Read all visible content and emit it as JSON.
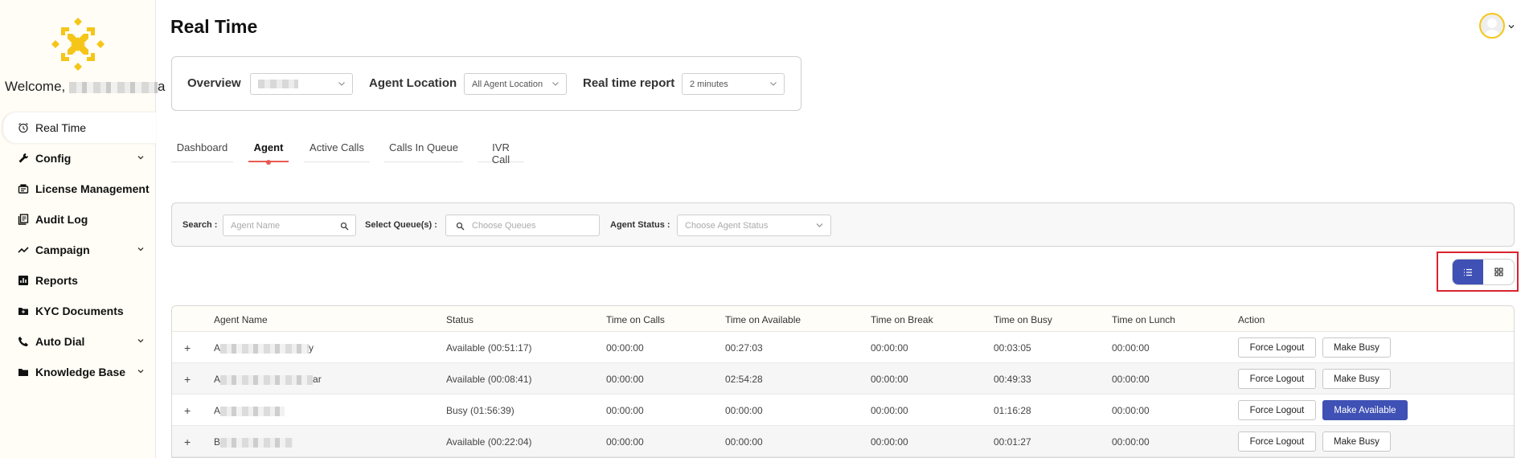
{
  "sidebar": {
    "welcome": "Welcome,",
    "welcome_tail": "a",
    "items": [
      {
        "label": "Real Time",
        "icon": "alarm-clock-icon"
      },
      {
        "label": "Config",
        "icon": "wrench-icon"
      },
      {
        "label": "License Management",
        "icon": "license-icon"
      },
      {
        "label": "Audit Log",
        "icon": "log-icon"
      },
      {
        "label": "Campaign",
        "icon": "trend-icon"
      },
      {
        "label": "Reports",
        "icon": "bar-chart-icon"
      },
      {
        "label": "KYC Documents",
        "icon": "folder-icon"
      },
      {
        "label": "Auto Dial",
        "icon": "phone-icon"
      },
      {
        "label": "Knowledge Base",
        "icon": "folder-icon"
      }
    ]
  },
  "header": {
    "title": "Real Time"
  },
  "overview": {
    "label": "Overview",
    "agent_location_label": "Agent Location",
    "agent_location_value": "All Agent Location",
    "report_label": "Real time report",
    "report_value": "2 minutes"
  },
  "tabs": [
    "Dashboard",
    "Agent",
    "Active Calls",
    "Calls In Queue",
    "IVR Call"
  ],
  "filters": {
    "search_label": "Search :",
    "search_placeholder": "Agent Name",
    "queue_label": "Select Queue(s) :",
    "queue_placeholder": "Choose Queues",
    "status_label": "Agent Status :",
    "status_placeholder": "Choose Agent Status"
  },
  "colors": {
    "accent": "#3f51b5",
    "tab_active": "#e85a4f",
    "brand": "#f5c518",
    "highlight": "#d9232e"
  },
  "table": {
    "headers": [
      "Agent Name",
      "Status",
      "Time on Calls",
      "Time on Available",
      "Time on Break",
      "Time on Busy",
      "Time on Lunch",
      "Action"
    ],
    "rows": [
      {
        "name_head": "A",
        "name_tail": "y",
        "status": "Available (00:51:17)",
        "calls": "00:00:00",
        "available": "00:27:03",
        "break": "00:00:00",
        "busy": "00:03:05",
        "lunch": "00:00:00",
        "btn1": "Force Logout",
        "btn2": "Make Busy"
      },
      {
        "name_head": "A",
        "name_tail": "ar",
        "status": "Available (00:08:41)",
        "calls": "00:00:00",
        "available": "02:54:28",
        "break": "00:00:00",
        "busy": "00:49:33",
        "lunch": "00:00:00",
        "btn1": "Force Logout",
        "btn2": "Make Busy"
      },
      {
        "name_head": "A",
        "name_tail": "",
        "status": "Busy (01:56:39)",
        "calls": "00:00:00",
        "available": "00:00:00",
        "break": "00:00:00",
        "busy": "01:16:28",
        "lunch": "00:00:00",
        "btn1": "Force Logout",
        "btn2": "Make Available"
      },
      {
        "name_head": "B",
        "name_tail": "",
        "status": "Available (00:22:04)",
        "calls": "00:00:00",
        "available": "00:00:00",
        "break": "00:00:00",
        "busy": "00:01:27",
        "lunch": "00:00:00",
        "btn1": "Force Logout",
        "btn2": "Make Busy"
      }
    ]
  }
}
